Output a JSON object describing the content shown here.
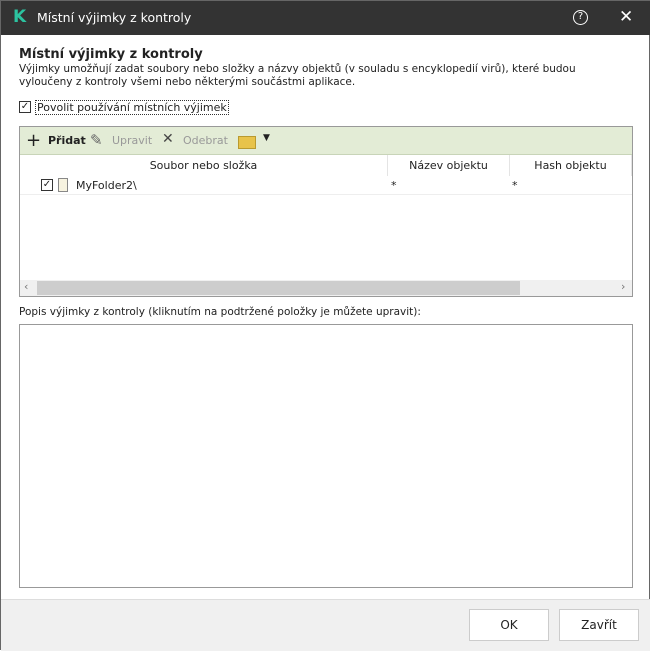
{
  "window": {
    "title": "Místní výjimky z kontroly",
    "logo": "K"
  },
  "heading": "Místní výjimky z kontroly",
  "description": "Výjimky umožňují zadat soubory nebo složky a názvy objektů (v souladu s encyklopedií virů), které budou vyloučeny z kontroly všemi nebo některými součástmi aplikace.",
  "enable": {
    "label": "Povolit používání místních výjimek",
    "checked": true
  },
  "toolbar": {
    "add": "Přidat",
    "edit": "Upravit",
    "remove": "Odebrat"
  },
  "table": {
    "columns": [
      "Soubor nebo složka",
      "Název objektu",
      "Hash objektu"
    ],
    "rows": [
      {
        "checked": true,
        "path": "MyFolder2\\",
        "object": "*",
        "hash": "*"
      }
    ]
  },
  "desc_label": "Popis výjimky z kontroly (kliknutím na podtržené položky je můžete upravit):",
  "buttons": {
    "ok": "OK",
    "close": "Zavřít"
  },
  "colors": {
    "accent": "#2cc3a0",
    "toolbar": "#e3ecd6"
  }
}
